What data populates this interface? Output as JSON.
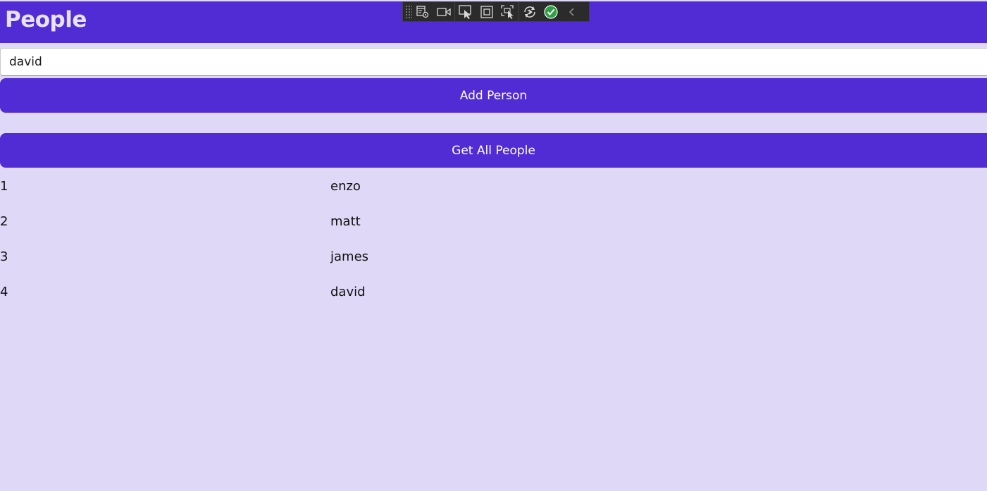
{
  "header": {
    "title": "People"
  },
  "debug_toolbar": {
    "icons": [
      "live-visual-tree-icon",
      "record-icon",
      "select-element-icon",
      "display-layout-adorners-icon",
      "track-focus-icon",
      "hot-reload-icon",
      "binding-status-ok-icon",
      "collapse-chevron-icon"
    ]
  },
  "form": {
    "name_value": "david",
    "add_button_label": "Add Person",
    "get_button_label": "Get All People"
  },
  "people": [
    {
      "id": "1",
      "name": "enzo"
    },
    {
      "id": "2",
      "name": "matt"
    },
    {
      "id": "3",
      "name": "james"
    },
    {
      "id": "4",
      "name": "david"
    }
  ],
  "colors": {
    "accent": "#512BD4",
    "background": "#DFD8F7",
    "header_text": "#E8E3FB"
  }
}
